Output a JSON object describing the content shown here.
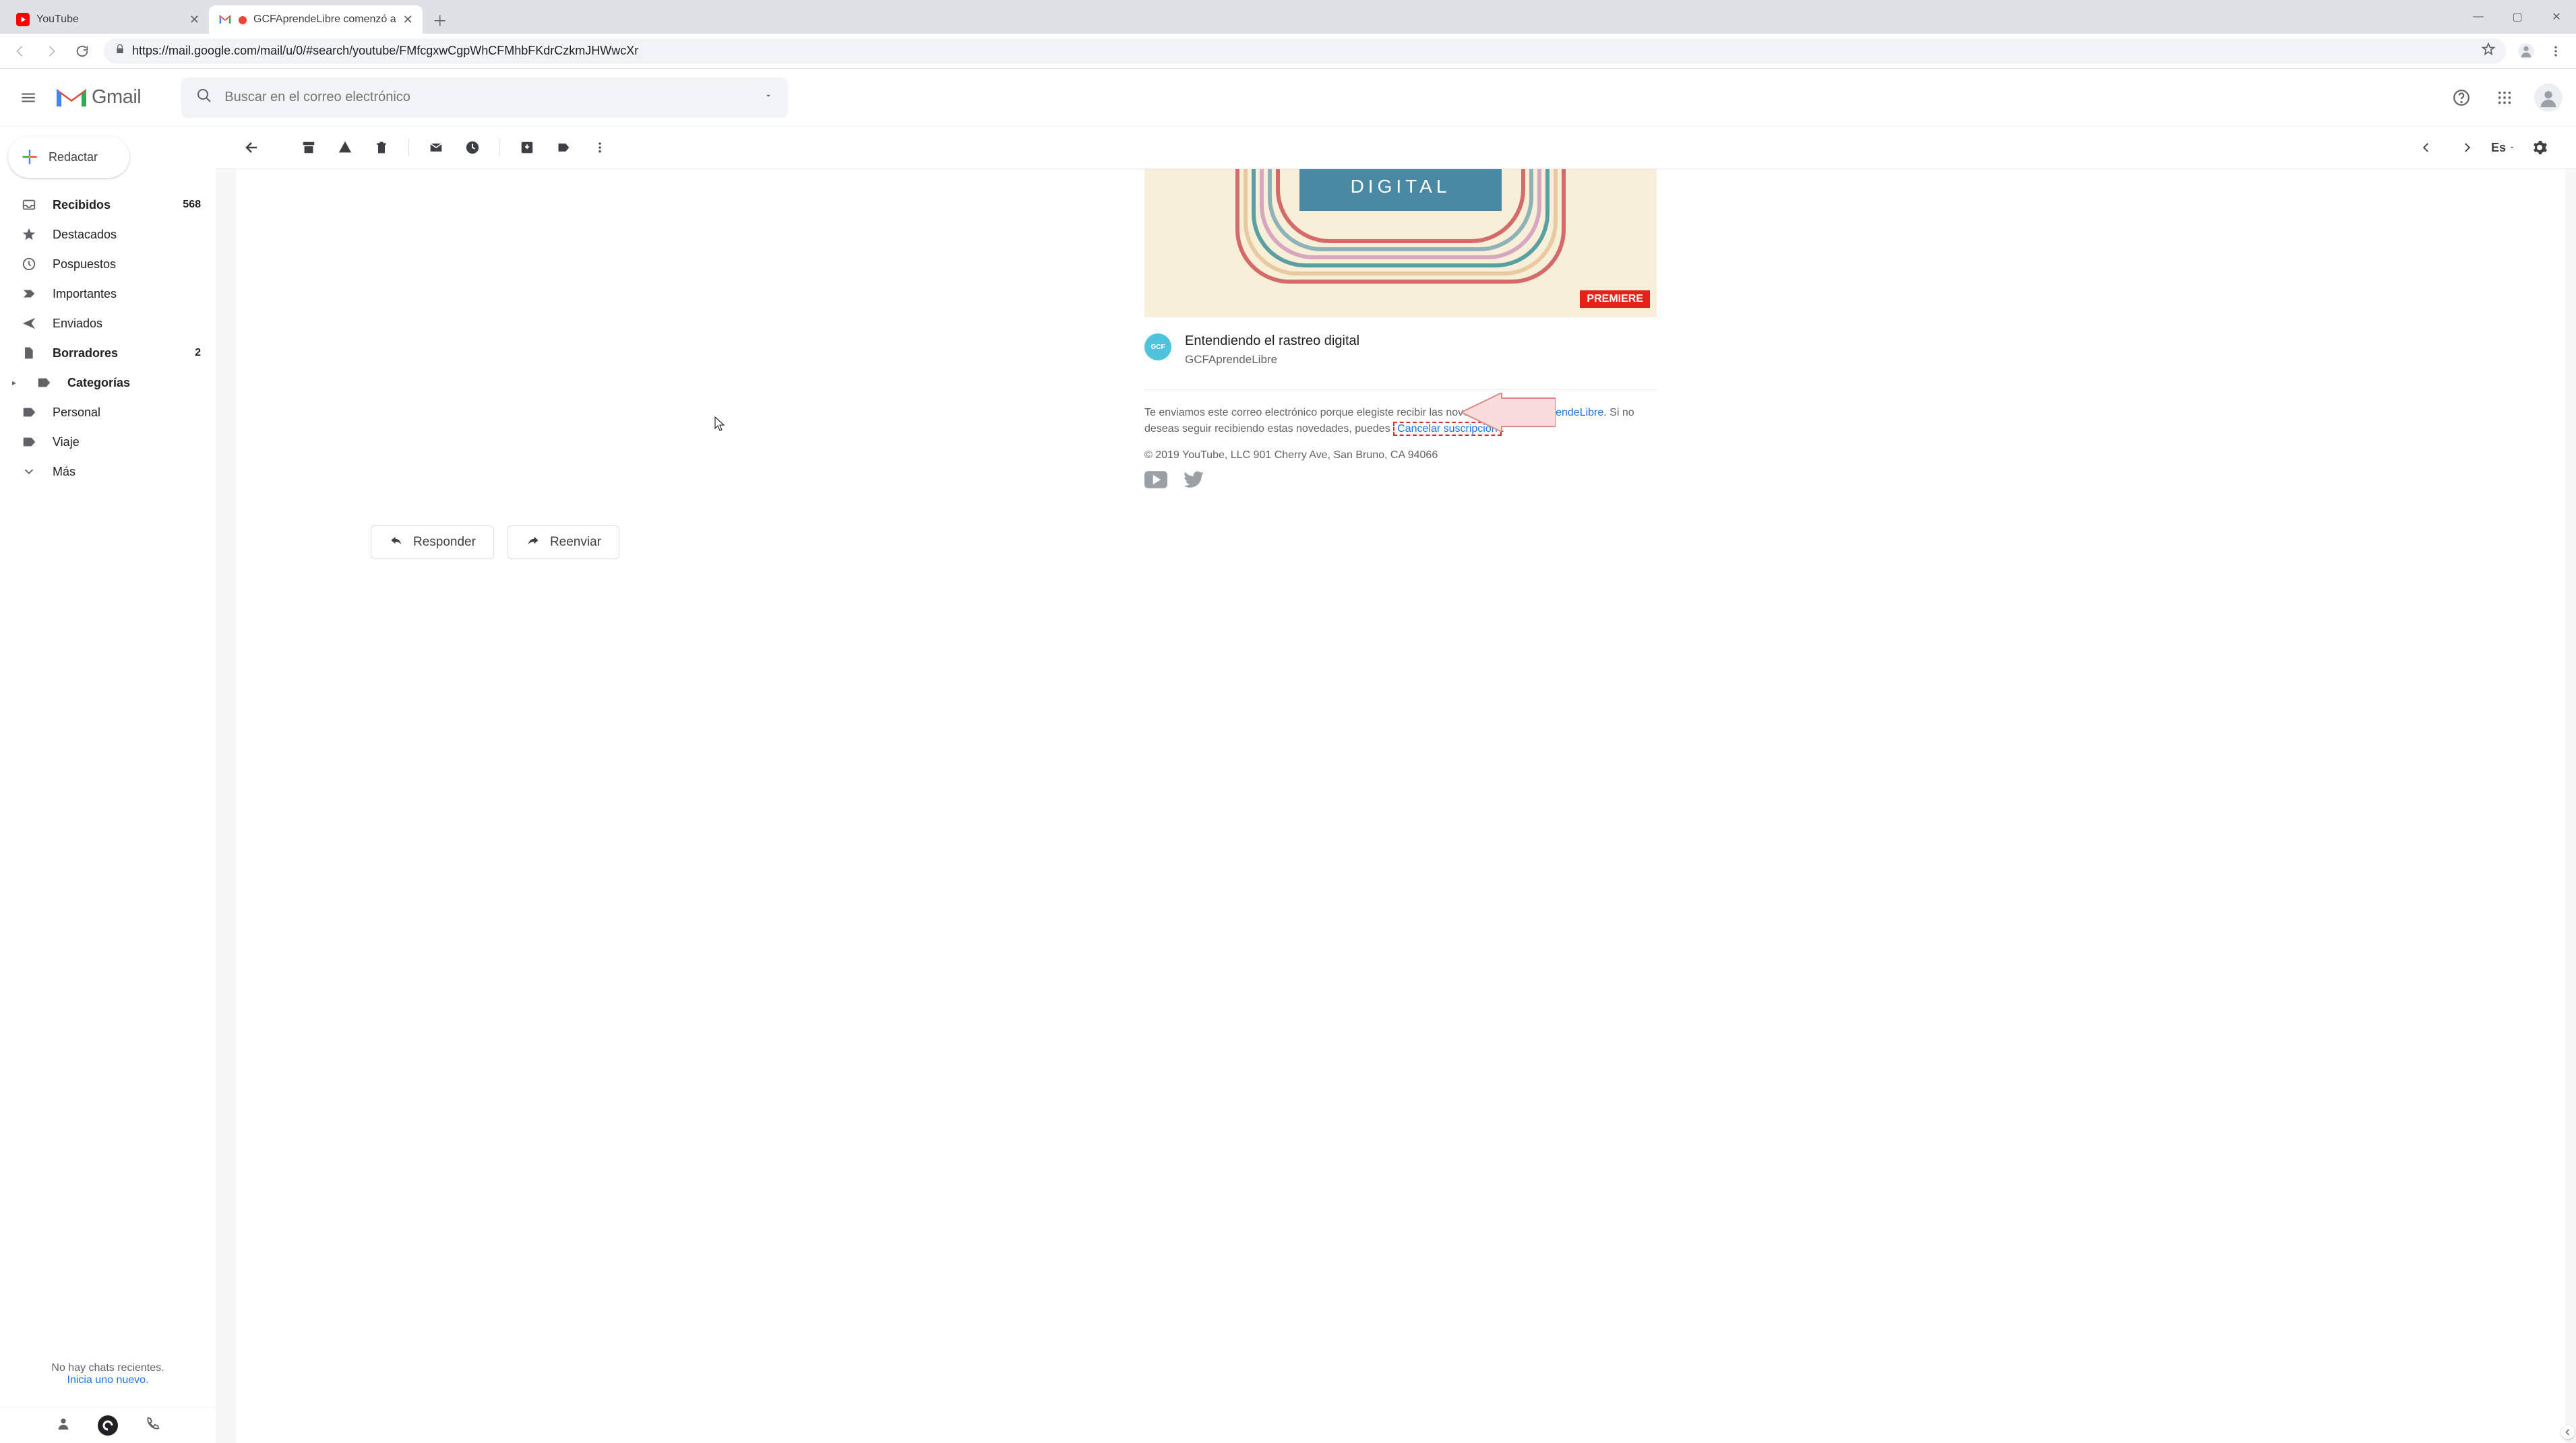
{
  "chrome": {
    "tabs": [
      {
        "title": "YouTube",
        "favicon": "youtube"
      },
      {
        "title": "GCFAprendeLibre comenzó a",
        "favicon": "gmail"
      }
    ],
    "url": "https://mail.google.com/mail/u/0/#search/youtube/FMfcgxwCgpWhCFMhbFKdrCzkmJHWwcXr",
    "window_controls": {
      "minimize": "—",
      "maximize": "▢",
      "close": "✕"
    }
  },
  "gmail": {
    "brand": "Gmail",
    "search_placeholder": "Buscar en el correo electrónico",
    "compose_label": "Redactar",
    "nav": [
      {
        "icon": "inbox",
        "label": "Recibidos",
        "count": "568",
        "bold": true
      },
      {
        "icon": "star",
        "label": "Destacados"
      },
      {
        "icon": "clock",
        "label": "Pospuestos"
      },
      {
        "icon": "important",
        "label": "Importantes"
      },
      {
        "icon": "send",
        "label": "Enviados"
      },
      {
        "icon": "draft",
        "label": "Borradores",
        "count": "2",
        "bold": true
      },
      {
        "icon": "label",
        "label": "Categorías",
        "bold": true,
        "expandable": true
      },
      {
        "icon": "label",
        "label": "Personal"
      },
      {
        "icon": "label",
        "label": "Viaje"
      },
      {
        "icon": "more",
        "label": "Más"
      }
    ],
    "hangouts_empty_1": "No hay chats recientes.",
    "hangouts_empty_2": "Inicia uno nuevo.",
    "lang_indicator": "Es"
  },
  "message": {
    "banner_word": "DIGITAL",
    "premiere_badge": "PREMIERE",
    "video_title": "Entendiendo el rastreo digital",
    "channel_name": "GCFAprendeLibre",
    "channel_badge": "GCF",
    "footer_pre": "Te enviamos este correo electrónico porque elegiste recibir las novedades de ",
    "footer_link_channel": "GCFAprendeLibre",
    "footer_mid": ". Si no deseas seguir recibiendo estas novedades, puedes ",
    "cancel_link": "Cancelar suscripción",
    "footer_period": ".",
    "copyright": "© 2019 YouTube, LLC 901 Cherry Ave, San Bruno, CA 94066",
    "reply_label": "Responder",
    "forward_label": "Reenviar"
  }
}
